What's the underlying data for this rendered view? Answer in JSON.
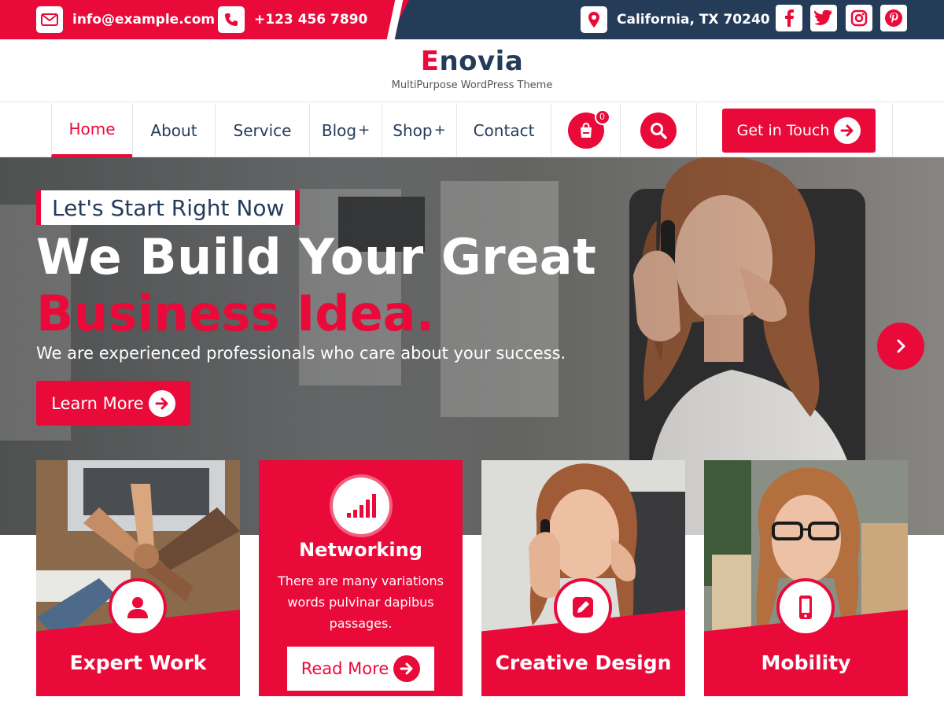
{
  "topbar": {
    "email": "info@example.com",
    "phone": "+123 456 7890",
    "location": "California, TX 70240",
    "social": [
      "facebook-icon",
      "twitter-icon",
      "instagram-icon",
      "pinterest-icon"
    ]
  },
  "brand": {
    "logo_first": "E",
    "logo_rest": "novia",
    "tagline": "MultiPurpose WordPress Theme"
  },
  "nav": {
    "items": [
      {
        "label": "Home",
        "plus": ""
      },
      {
        "label": "About",
        "plus": ""
      },
      {
        "label": "Service",
        "plus": ""
      },
      {
        "label": "Blog",
        "plus": "+"
      },
      {
        "label": "Shop",
        "plus": "+"
      },
      {
        "label": "Contact",
        "plus": ""
      }
    ],
    "cart_count": "0",
    "cta": "Get in Touch"
  },
  "hero": {
    "kicker": "Let's Start Right Now",
    "headline_1": "We Build Your Great",
    "headline_2": "Business Idea.",
    "subtitle": "We are experienced professionals who care about your success.",
    "button": "Learn More"
  },
  "cards": [
    {
      "title": "Expert Work",
      "icon": "user-icon"
    },
    {
      "title": "Networking",
      "icon": "signal-bars-icon",
      "desc": "There are many variations words pulvinar dapibus passages.",
      "button": "Read More"
    },
    {
      "title": "Creative Design",
      "icon": "pencil-square-icon"
    },
    {
      "title": "Mobility",
      "icon": "mobile-phone-icon"
    }
  ],
  "colors": {
    "accent": "#ea0a39",
    "navy": "#253c59"
  }
}
